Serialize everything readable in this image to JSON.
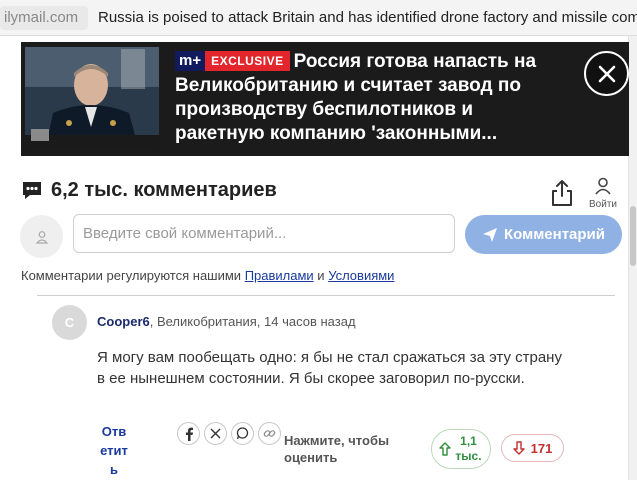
{
  "browser": {
    "domain": "ilymail.com",
    "tab_title": "Russia is poised to attack Britain and has identified drone factory and missile company as 'legitimate targets'"
  },
  "hero": {
    "badge_brand": "m+",
    "badge_label": "EXCLUSIVE",
    "headline": "Россия готова напасть на Великобританию и считает завод по производству беспилотников и ракетную компанию 'законными...",
    "close_icon": "close-icon"
  },
  "comments": {
    "count_label": "6,2 тыс. комментариев",
    "login_label": "Войти",
    "composer": {
      "placeholder": "Введите свой комментарий...",
      "submit_label": "Комментарий"
    },
    "rules": {
      "prefix": "Комментарии регулируются нашими ",
      "rules_link": "Правилами",
      "and": " и ",
      "terms_link": "Условиями"
    },
    "items": [
      {
        "avatar_letter": "C",
        "author": "Cooper6",
        "location_time": ", Великобритания, 14 часов назад",
        "body": "Я могу вам пообещать одно: я бы не стал сражаться за эту страну в ее нынешнем состоянии. Я бы скорее заговорил по-русски.",
        "reply_label": "Ответить",
        "rate_label": "Нажмите, чтобы оценить",
        "upvotes": "1,1 тыс.",
        "downvotes": "171"
      }
    ]
  },
  "colors": {
    "accent_blue": "#1a3a9c",
    "submit_bg": "#8fb1e3",
    "exclusive_red": "#e3262b",
    "upvote_green": "#2f8f3a",
    "downvote_red": "#c42f2f"
  }
}
